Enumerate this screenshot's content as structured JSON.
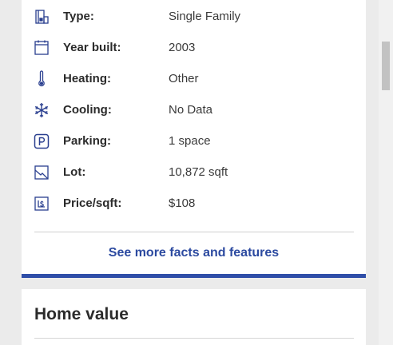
{
  "facts": [
    {
      "icon": "home-type-icon",
      "label": "Type:",
      "value": "Single Family"
    },
    {
      "icon": "calendar-icon",
      "label": "Year built:",
      "value": "2003"
    },
    {
      "icon": "thermometer-icon",
      "label": "Heating:",
      "value": "Other"
    },
    {
      "icon": "snowflake-icon",
      "label": "Cooling:",
      "value": "No Data"
    },
    {
      "icon": "parking-icon",
      "label": "Parking:",
      "value": "1 space"
    },
    {
      "icon": "lot-icon",
      "label": "Lot:",
      "value": "10,872 sqft"
    },
    {
      "icon": "price-per-sqft-icon",
      "label": "Price/sqft:",
      "value": "$108"
    }
  ],
  "more_link_label": "See more facts and features",
  "home_value": {
    "title": "Home value"
  },
  "colors": {
    "accent": "#2f4ea8",
    "link": "#2c4aa0",
    "icon": "#2a3f8f"
  }
}
